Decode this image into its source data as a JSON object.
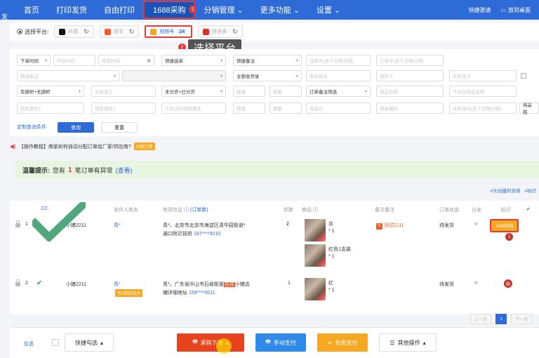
{
  "nav": {
    "brand": "发",
    "items": [
      {
        "label": "首页"
      },
      {
        "label": "打印发货"
      },
      {
        "label": "自由打印"
      },
      {
        "label": "1688采购",
        "badge": "1"
      },
      {
        "label": "分销管理",
        "caret": "⌄"
      },
      {
        "label": "更多功能",
        "caret": "⌄"
      },
      {
        "label": "设置",
        "caret": "⌄"
      }
    ],
    "right": [
      "快捷邀请",
      "放到桌面"
    ]
  },
  "platforms": {
    "label": "选择平台:",
    "items": [
      {
        "name": "抖音",
        "color": "#111111"
      },
      {
        "name": "快手",
        "color": "#ff5b2c"
      },
      {
        "name": "视频号",
        "count": "24",
        "color": "#f5a623"
      },
      {
        "name": "拼多多",
        "color": "#e02e24"
      }
    ],
    "tip_marker": "2",
    "tooltip": "选择平台"
  },
  "filters": {
    "row1": [
      "下单时间",
      "开始时间",
      "结束时间",
      "快捷选单",
      "快捷备注",
      "运单号(多个空格分隔)",
      "订单号(多个空格分隔)"
    ],
    "row2": [
      "精选商品",
      "全部收货省",
      "收货姓名",
      "收件人",
      "买家留言"
    ],
    "row3": [
      "有旗帜+无旗帜",
      "买家留言",
      "未分货+已分货",
      "数量",
      "数量",
      "订单备注筛选",
      "商品名称",
      "不包含商品名称"
    ],
    "row4": [
      "销售属性1",
      "销售属性2",
      "不包含的销售属性",
      "数量",
      "数量",
      "商品ID",
      "商家编码",
      "采购单ID(多个空格分隔)",
      "待采购"
    ],
    "custom_link": "定制查询条件",
    "query": "查询",
    "reset": "重置"
  },
  "notice": {
    "text": "【操作教程】商家如何自动分配订单给厂家/供应商?",
    "tag": "分配订单"
  },
  "alert": {
    "prefix": "温馨提示:",
    "pre": "您有",
    "count": "1",
    "post": "笔订单有异常",
    "link": "(查看)"
  },
  "right_links": [
    "#头创建的咨询",
    "#标识"
  ],
  "table": {
    "headers": {
      "count": "2/2",
      "receiver": "收件人姓名",
      "address": "收货信息",
      "address_extra": "(订单数)",
      "qty": "件数",
      "product": "商品",
      "seller_memo": "备注备注",
      "status": "订单状态",
      "split": "分发",
      "mark": "标识"
    },
    "rows": [
      {
        "index": "1",
        "shop": "小猪2211",
        "receiver": "青*",
        "address_line1": "青*，北京市北京市海淀区清华园街道*",
        "address_line2": "通口附近技校",
        "phone": "187****0010",
        "qty": "2",
        "item1_name": "灰",
        "item1_qty": "* 1",
        "item2_name": "红色1支装",
        "item2_qty": "* 1",
        "memo": "测试2111",
        "status": "待发货",
        "action": "1688采购",
        "action_marker": "1"
      },
      {
        "index": "2",
        "shop": "小猪2211",
        "receiver": "青*",
        "receiver_tag": "有2单待合并",
        "address_line1": "青*，广东省中山市石岐街道",
        "address_flag": "合并",
        "address_line1b": "小猪店",
        "address_line2": "辅详细地址",
        "phone": "159****0011",
        "qty": "1",
        "item1_name": "红",
        "item1_qty": "* 1",
        "status": "待发货",
        "action_marker": "购"
      }
    ]
  },
  "pager": {
    "prev": "上一页",
    "current": "1",
    "next": "下一页"
  },
  "bottom": {
    "invert": "反选",
    "quick_pick": "快捷勾选",
    "purchase": "采购下单",
    "manual_pay": "手动支付",
    "free_pay": "免密支付",
    "other": "其他操作"
  },
  "colors": {
    "nav_bg": "#2f6bd6",
    "accent_red": "#e53935",
    "orange": "#f7a823",
    "green_check": "#3d9e6e"
  }
}
